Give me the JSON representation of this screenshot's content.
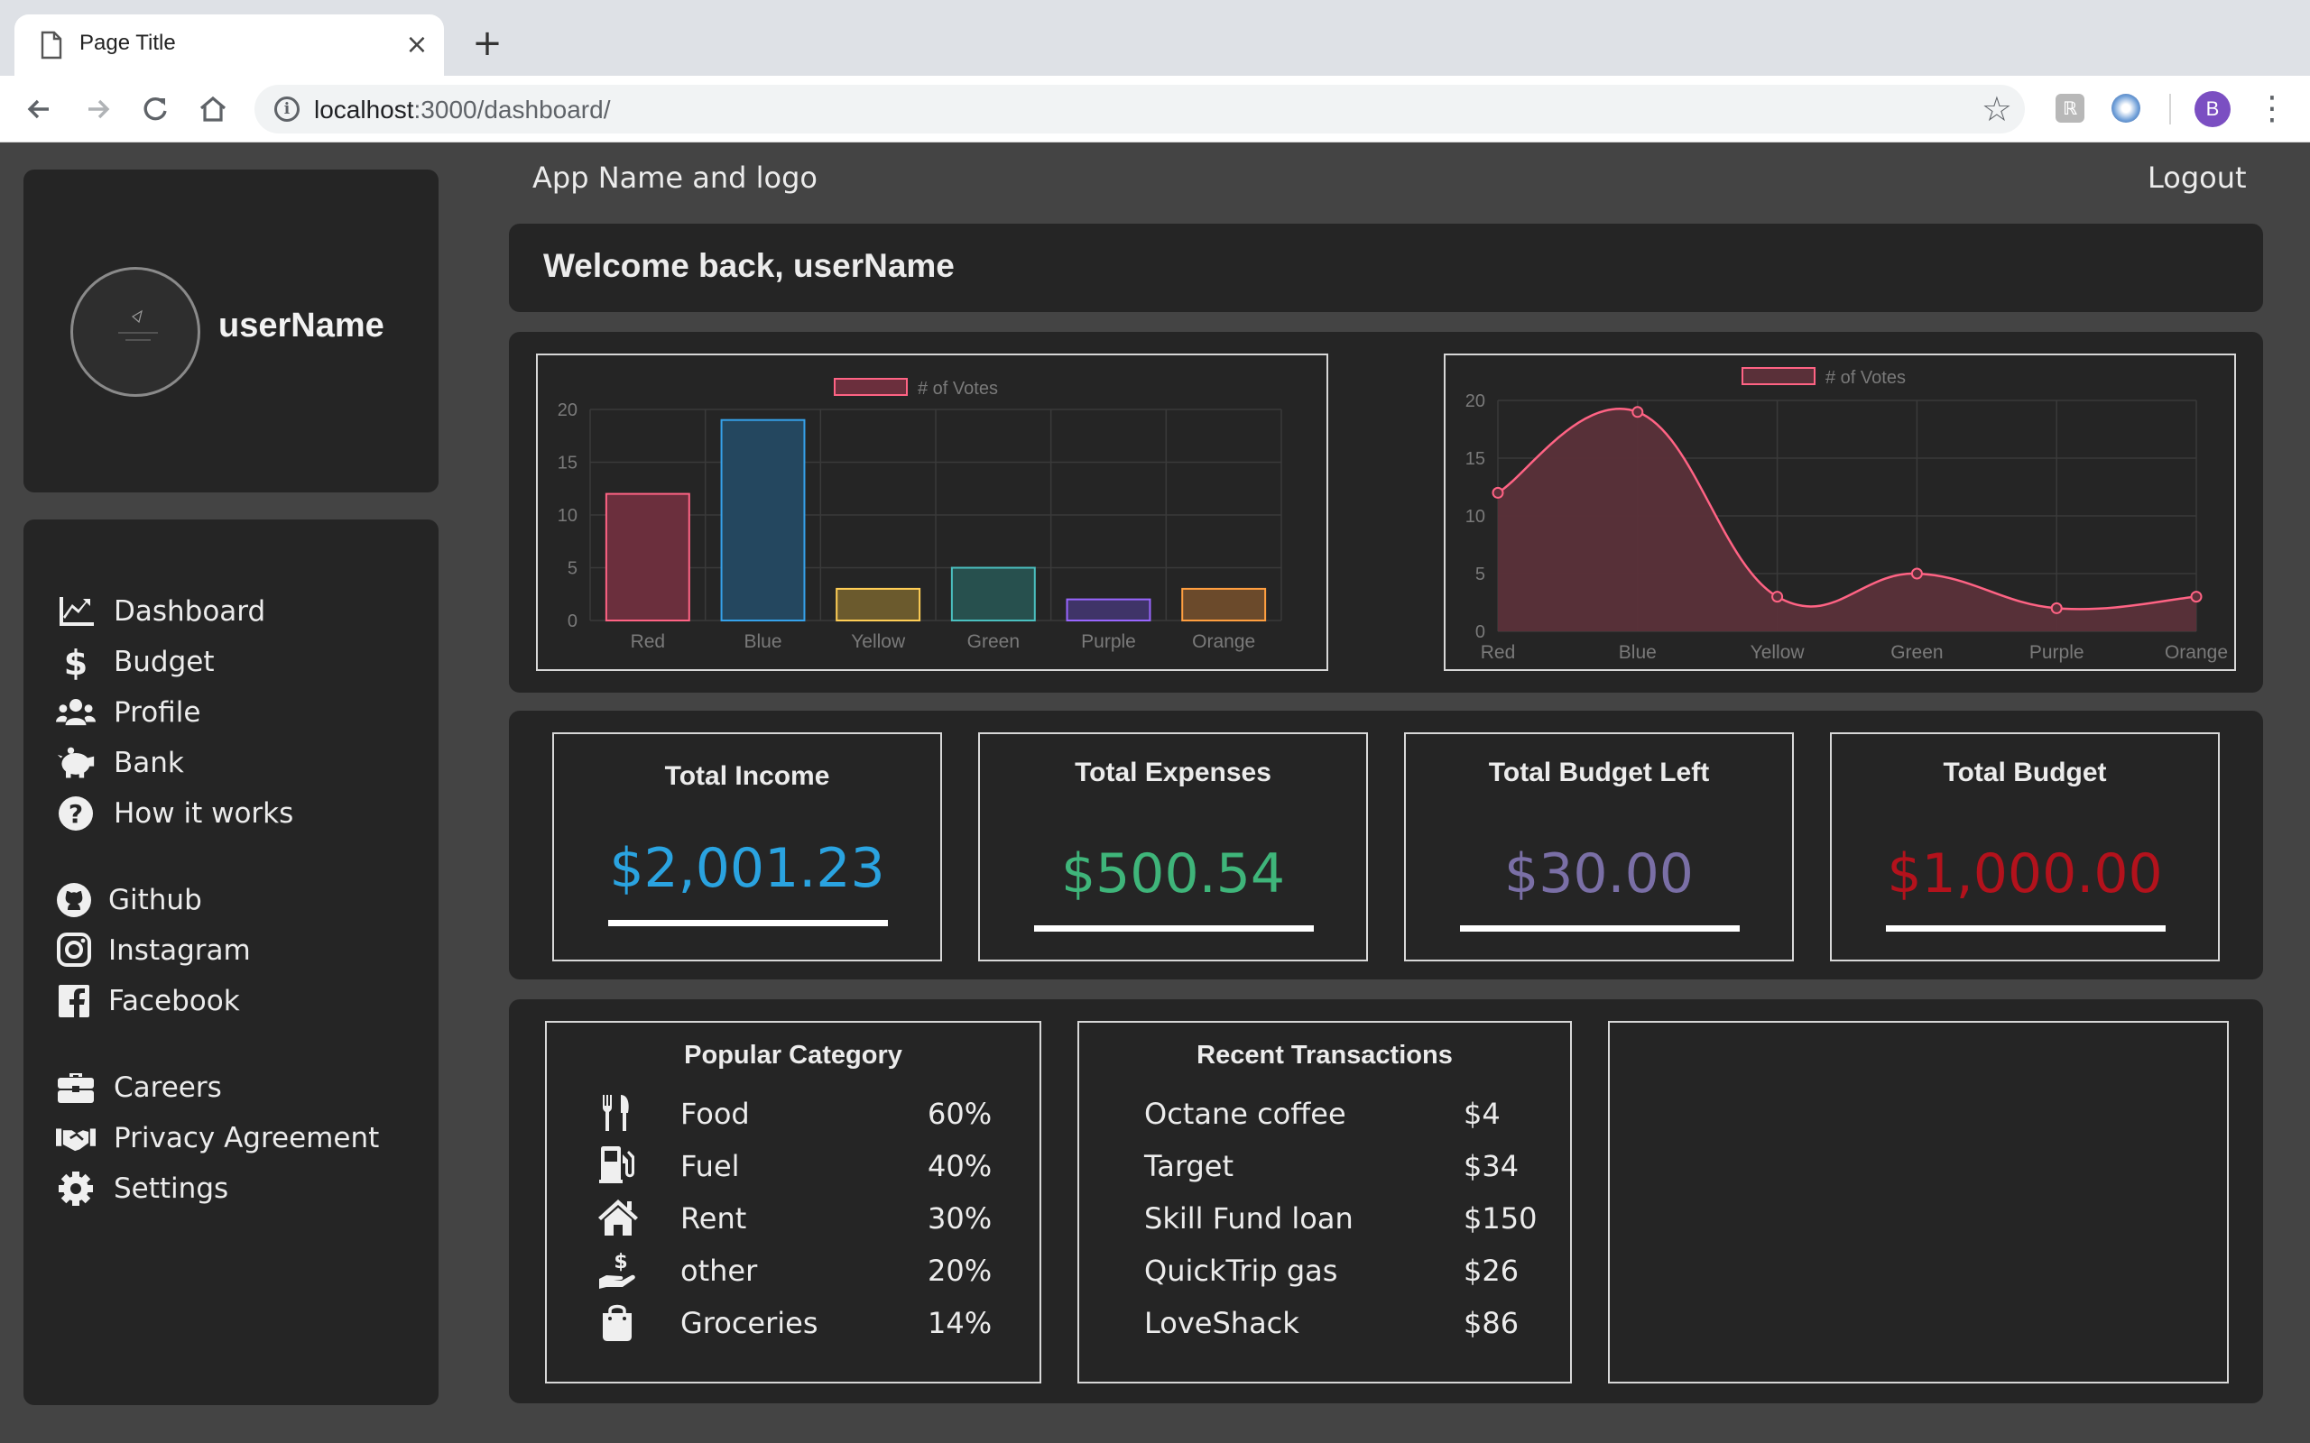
{
  "browser": {
    "tab_title": "Page Title",
    "url_host": "localhost",
    "url_rest": ":3000/dashboard/",
    "profile_initial": "B"
  },
  "header": {
    "app_title": "App Name and logo",
    "logout_label": "Logout"
  },
  "profile": {
    "username": "userName"
  },
  "nav": {
    "main": [
      {
        "label": "Dashboard",
        "icon": "chart-line-icon"
      },
      {
        "label": "Budget",
        "icon": "dollar-icon"
      },
      {
        "label": "Profile",
        "icon": "users-icon"
      },
      {
        "label": "Bank",
        "icon": "piggy-bank-icon"
      },
      {
        "label": "How it works",
        "icon": "question-circle-icon"
      }
    ],
    "social": [
      {
        "label": "Github",
        "icon": "github-icon"
      },
      {
        "label": "Instagram",
        "icon": "instagram-icon"
      },
      {
        "label": "Facebook",
        "icon": "facebook-icon"
      }
    ],
    "company": [
      {
        "label": "Careers",
        "icon": "briefcase-icon"
      },
      {
        "label": "Privacy Agreement",
        "icon": "handshake-icon"
      },
      {
        "label": "Settings",
        "icon": "gear-icon"
      }
    ]
  },
  "welcome": {
    "text": "Welcome back, userName"
  },
  "chart_data": [
    {
      "type": "bar",
      "categories": [
        "Red",
        "Blue",
        "Yellow",
        "Green",
        "Purple",
        "Orange"
      ],
      "series": [
        {
          "name": "# of Votes",
          "values": [
            12,
            19,
            3,
            5,
            2,
            3
          ]
        }
      ],
      "ylim": [
        0,
        20
      ],
      "yticks": [
        0,
        5,
        10,
        15,
        20
      ],
      "legend": "top",
      "grid": true,
      "colors": {
        "fill": [
          "#6b2f3d",
          "#24475f",
          "#6b5a2d",
          "#27504e",
          "#3f3468",
          "#6b4a2b"
        ],
        "stroke": [
          "#ff6384",
          "#36a2eb",
          "#ffce56",
          "#4bc0c0",
          "#9966ff",
          "#ff9f40"
        ]
      }
    },
    {
      "type": "area",
      "categories": [
        "Red",
        "Blue",
        "Yellow",
        "Green",
        "Purple",
        "Orange"
      ],
      "series": [
        {
          "name": "# of Votes",
          "values": [
            12,
            19,
            3,
            5,
            2,
            3
          ]
        }
      ],
      "ylim": [
        0,
        20
      ],
      "yticks": [
        0,
        5,
        10,
        15,
        20
      ],
      "legend": "top",
      "grid": true,
      "colors": {
        "fill": "#5a3039",
        "stroke": "#ff6384"
      }
    }
  ],
  "stats": [
    {
      "title": "Total Income",
      "value": "$2,001.23",
      "color": "#2aa3e0"
    },
    {
      "title": "Total Expenses",
      "value": "$500.54",
      "color": "#3fb57a"
    },
    {
      "title": "Total Budget Left",
      "value": "$30.00",
      "color": "#7a6fa6"
    },
    {
      "title": "Total Budget",
      "value": "$1,000.00",
      "color": "#b3121c"
    }
  ],
  "popular": {
    "title": "Popular Category",
    "items": [
      {
        "label": "Food",
        "pct": "60%",
        "icon": "utensils-icon"
      },
      {
        "label": "Fuel",
        "pct": "40%",
        "icon": "gas-pump-icon"
      },
      {
        "label": "Rent",
        "pct": "30%",
        "icon": "home-icon"
      },
      {
        "label": "other",
        "pct": "20%",
        "icon": "hand-dollar-icon"
      },
      {
        "label": "Groceries",
        "pct": "14%",
        "icon": "shopping-bag-icon"
      }
    ]
  },
  "transactions": {
    "title": "Recent Transactions",
    "items": [
      {
        "name": "Octane coffee",
        "amount": "$4"
      },
      {
        "name": "Target",
        "amount": "$34"
      },
      {
        "name": "Skill Fund loan",
        "amount": "$150"
      },
      {
        "name": "QuickTrip gas",
        "amount": "$26"
      },
      {
        "name": "LoveShack",
        "amount": "$86"
      }
    ]
  }
}
